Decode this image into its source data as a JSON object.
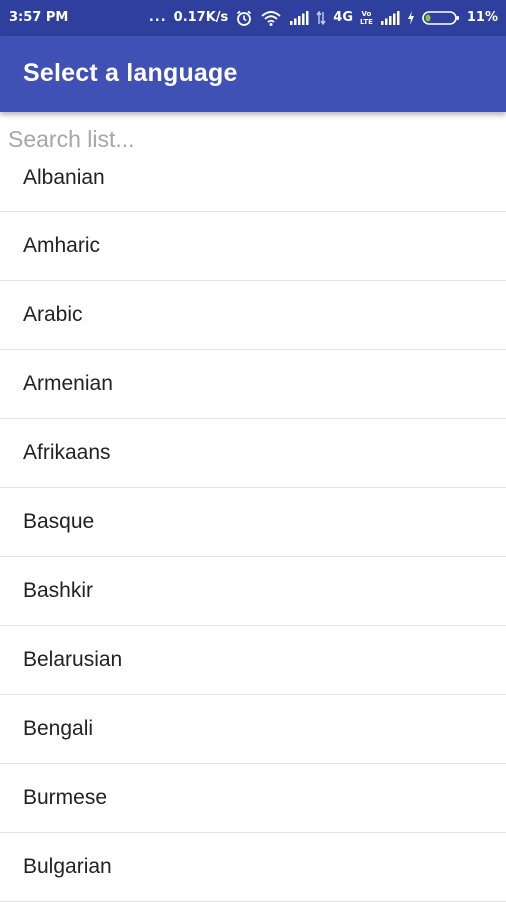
{
  "status_bar": {
    "time": "3:57 PM",
    "dots": "...",
    "net_speed": "0.17K/s",
    "network_type": "4G",
    "volte_top": "Vo",
    "volte_bottom": "LTE",
    "battery": "11%",
    "icons": [
      "alarm-icon",
      "wifi-icon",
      "signal-icon",
      "data-arrows-icon",
      "signal-icon",
      "charging-icon",
      "battery-icon"
    ]
  },
  "app_bar": {
    "title": "Select a language",
    "color": "#3f51b5",
    "status_color": "#2f3f9e"
  },
  "search": {
    "placeholder": "Search list...",
    "value": ""
  },
  "languages": [
    "Albanian",
    "Amharic",
    "Arabic",
    "Armenian",
    "Afrikaans",
    "Basque",
    "Bashkir",
    "Belarusian",
    "Bengali",
    "Burmese",
    "Bulgarian"
  ]
}
